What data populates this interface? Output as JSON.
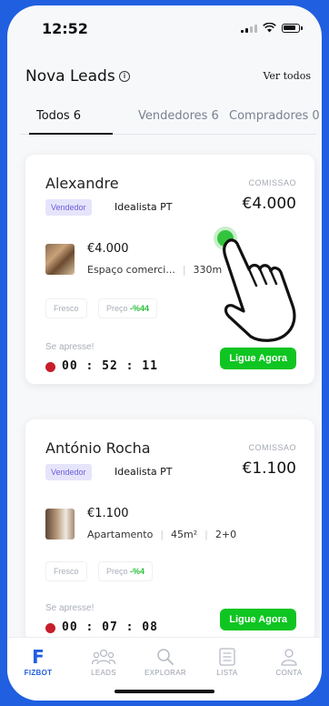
{
  "status": {
    "time": "12:52"
  },
  "header": {
    "title": "Nova Leads",
    "ver_todos": "Ver todos"
  },
  "tabs": [
    {
      "label": "Todos 6",
      "active": true
    },
    {
      "label": "Vendedores 6",
      "active": false
    },
    {
      "label": "Compradores 0",
      "active": false
    }
  ],
  "cards": [
    {
      "name": "Alexandre",
      "comissao_label": "COMISSAO",
      "comissao_value": "€4.000",
      "badge": "Vendedor",
      "source": "Idealista PT",
      "property_price": "€4.000",
      "property_type": "Espaço comerci...",
      "property_area": "330m",
      "tag_fresco": "Fresco",
      "tag_preco_label": "Preço",
      "tag_preco_value": "-%44",
      "urgency": "Se apresse!",
      "timer": "00 : 52 : 11",
      "cta": "Ligue Agora"
    },
    {
      "name": "António Rocha",
      "comissao_label": "COMISSAO",
      "comissao_value": "€1.100",
      "badge": "Vendedor",
      "source": "Idealista PT",
      "property_price": "€1.100",
      "property_type": "Apartamento",
      "property_area": "45m²",
      "property_rooms": "2+0",
      "tag_fresco": "Fresco",
      "tag_preco_label": "Preço",
      "tag_preco_value": "-%4",
      "urgency": "Se apresse!",
      "timer": "00 : 07 : 08",
      "cta": "Ligue Agora"
    }
  ],
  "nav": {
    "fizbot_logo": "F",
    "items": [
      {
        "label": "FIZBOT",
        "icon": "fizbot-logo",
        "active": true
      },
      {
        "label": "LEADS",
        "icon": "leads-icon",
        "active": false
      },
      {
        "label": "EXPLORAR",
        "icon": "search-icon",
        "active": false
      },
      {
        "label": "LISTA",
        "icon": "list-icon",
        "active": false
      },
      {
        "label": "CONTA",
        "icon": "user-icon",
        "active": false
      }
    ]
  },
  "colors": {
    "brand": "#1f5fe0",
    "cta": "#0fc521",
    "badge_bg": "#e6e4fb",
    "badge_text": "#6a5fd8",
    "timer_icon": "#c81d2a"
  }
}
